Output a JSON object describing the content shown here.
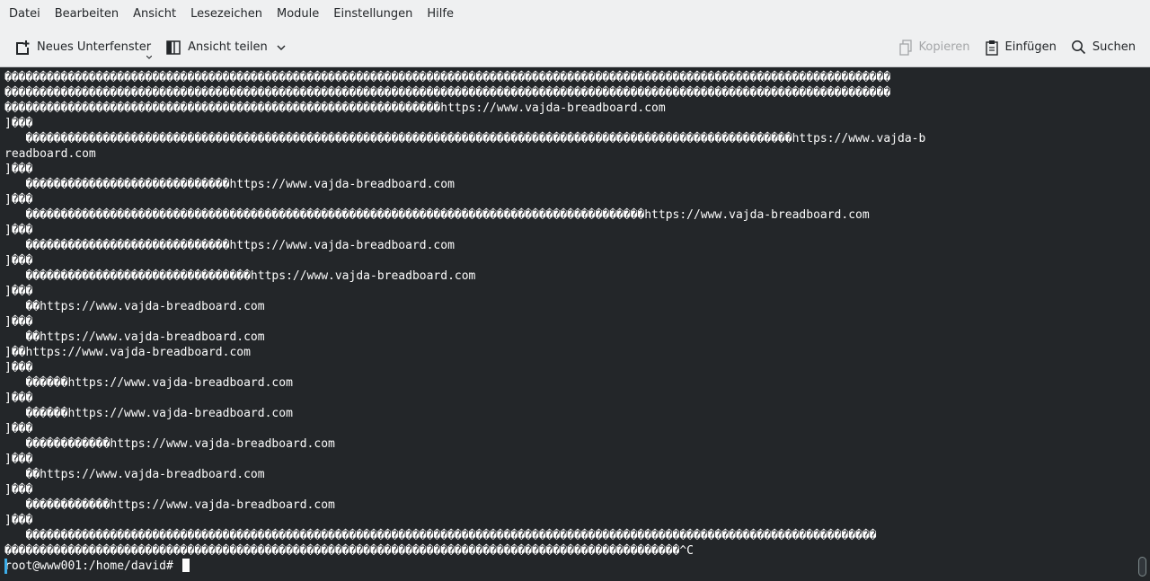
{
  "menubar": {
    "items": [
      "Datei",
      "Bearbeiten",
      "Ansicht",
      "Lesezeichen",
      "Module",
      "Einstellungen",
      "Hilfe"
    ]
  },
  "toolbar": {
    "new_tab_label": "Neues Unterfenster",
    "split_view_label": "Ansicht teilen",
    "copy_label": "Kopieren",
    "paste_label": "Einfügen",
    "search_label": "Suchen"
  },
  "terminal": {
    "lines": [
      "������������������������������������������������������������������������������������������������������������������������������",
      "������������������������������������������������������������������������������������������������������������������������������",
      "��������������������������������������������������������������https://www.vajda-breadboard.com",
      "]���",
      "   �������������������������������������������������������������������������������������������������������������https://www.vajda-b",
      "readboard.com",
      "]���",
      "   �����������������������������https://www.vajda-breadboard.com",
      "]���",
      "   ����������������������������������������������������������������������������������������https://www.vajda-breadboard.com",
      "]���",
      "   �����������������������������https://www.vajda-breadboard.com",
      "]���",
      "   ��������������������������������https://www.vajda-breadboard.com",
      "]���",
      "   ��https://www.vajda-breadboard.com",
      "]���",
      "   ��https://www.vajda-breadboard.com",
      "]��https://www.vajda-breadboard.com",
      "]���",
      "   ������https://www.vajda-breadboard.com",
      "]���",
      "   ������https://www.vajda-breadboard.com",
      "]���",
      "   ������������https://www.vajda-breadboard.com",
      "]���",
      "   ��https://www.vajda-breadboard.com",
      "]���",
      "   ������������https://www.vajda-breadboard.com",
      "]���",
      "   �������������������������������������������������������������������������������������������������������������������������",
      "������������������������������������������������������������������������������������������������^C"
    ],
    "prompt": "root@www001:/home/david# "
  },
  "colors": {
    "terminal_bg": "#232629",
    "terminal_fg": "#fcfcfc",
    "chrome_bg": "#eff0f1",
    "accent": "#3daee9"
  }
}
